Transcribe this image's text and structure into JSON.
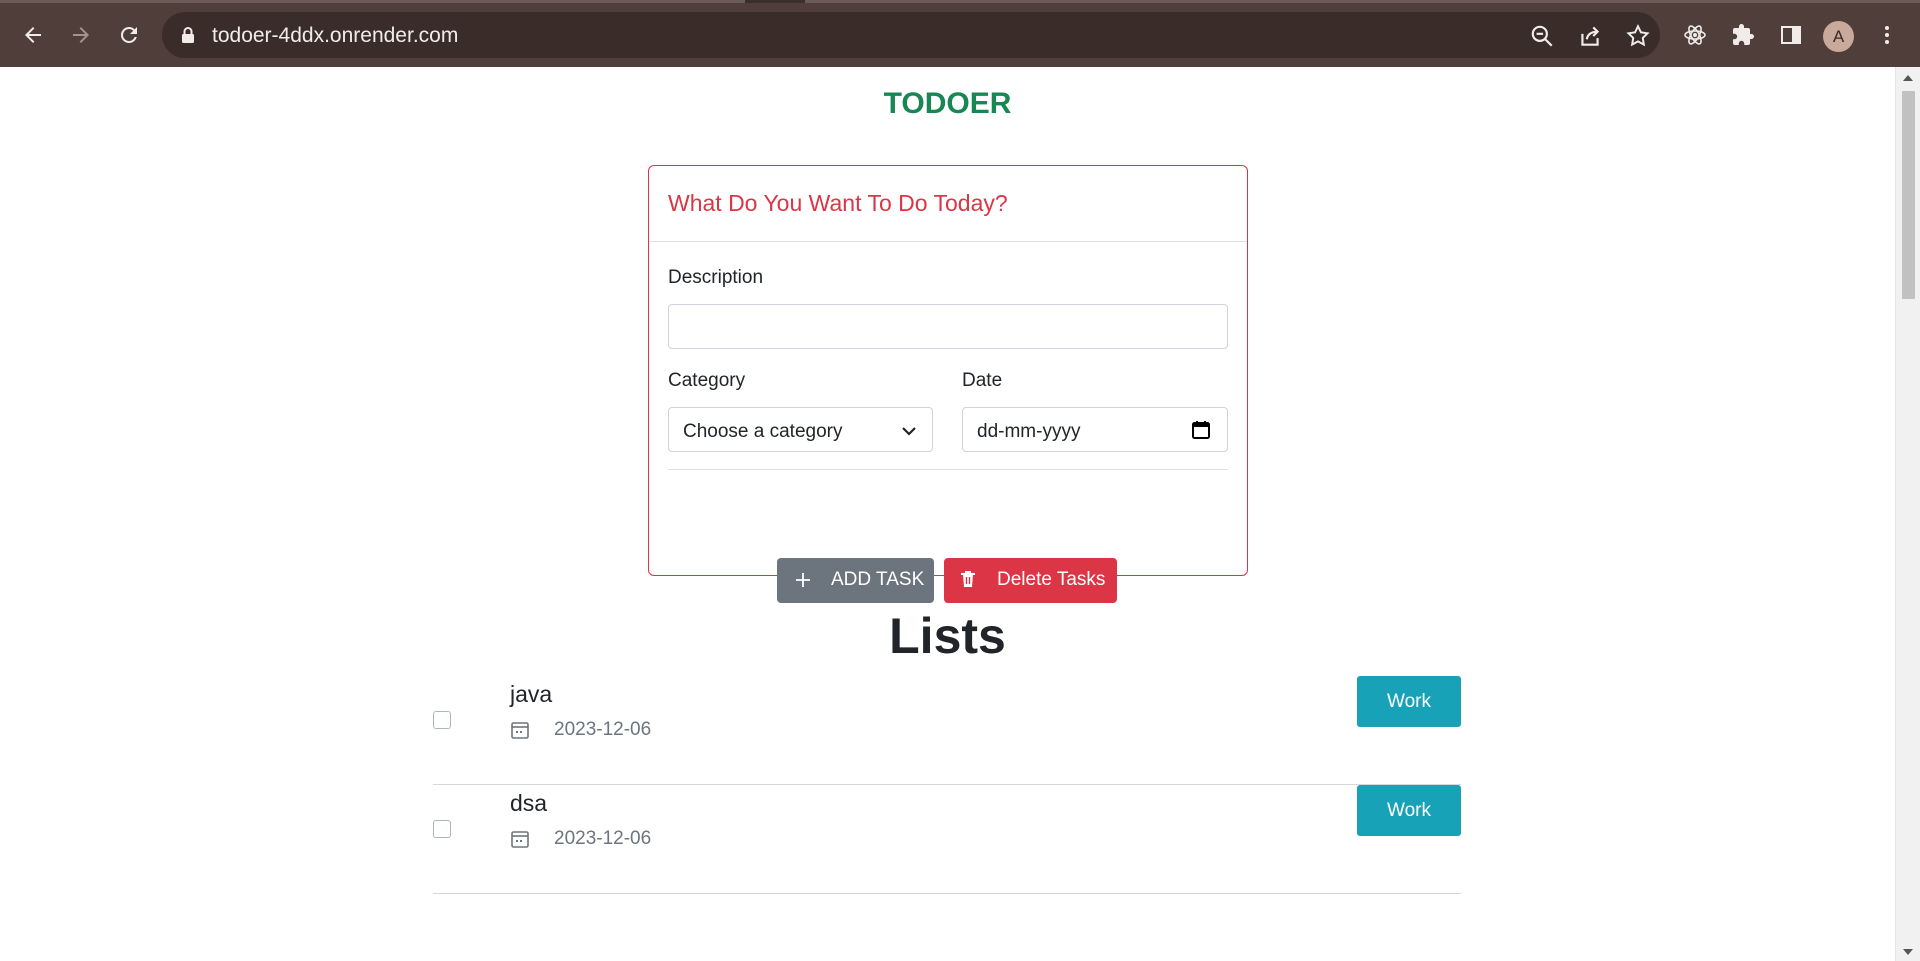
{
  "browser": {
    "url": "todoer-4ddx.onrender.com",
    "profile_initial": "A",
    "icons": {
      "back": "back-arrow-icon",
      "forward": "forward-arrow-icon",
      "reload": "reload-icon",
      "lock": "lock-icon",
      "zoom": "zoom-out-icon",
      "share": "share-icon",
      "bookmark": "star-icon",
      "react_devtools": "react-icon",
      "extensions": "puzzle-icon",
      "side_panel": "side-panel-icon",
      "menu": "kebab-menu-icon"
    },
    "colors": {
      "frame": "#4f3e3a",
      "omnibox": "#3a2c29"
    }
  },
  "app": {
    "brand": "TODOER",
    "colors": {
      "brand": "#198754",
      "danger": "#dc3545",
      "secondary": "#6c757d",
      "info": "#17a2b8"
    }
  },
  "form": {
    "title": "What Do You Want To Do Today?",
    "description_label": "Description",
    "description_value": "",
    "category_label": "Category",
    "category_selected": "Choose a category",
    "date_label": "Date",
    "date_placeholder": "dd-mm-yyyy",
    "add_button": "ADD TASK",
    "delete_button": "Delete Tasks"
  },
  "lists": {
    "heading": "Lists",
    "tasks": [
      {
        "title": "java",
        "date": "2023-12-06",
        "category": "Work",
        "done": false
      },
      {
        "title": "dsa",
        "date": "2023-12-06",
        "category": "Work",
        "done": false
      }
    ]
  }
}
